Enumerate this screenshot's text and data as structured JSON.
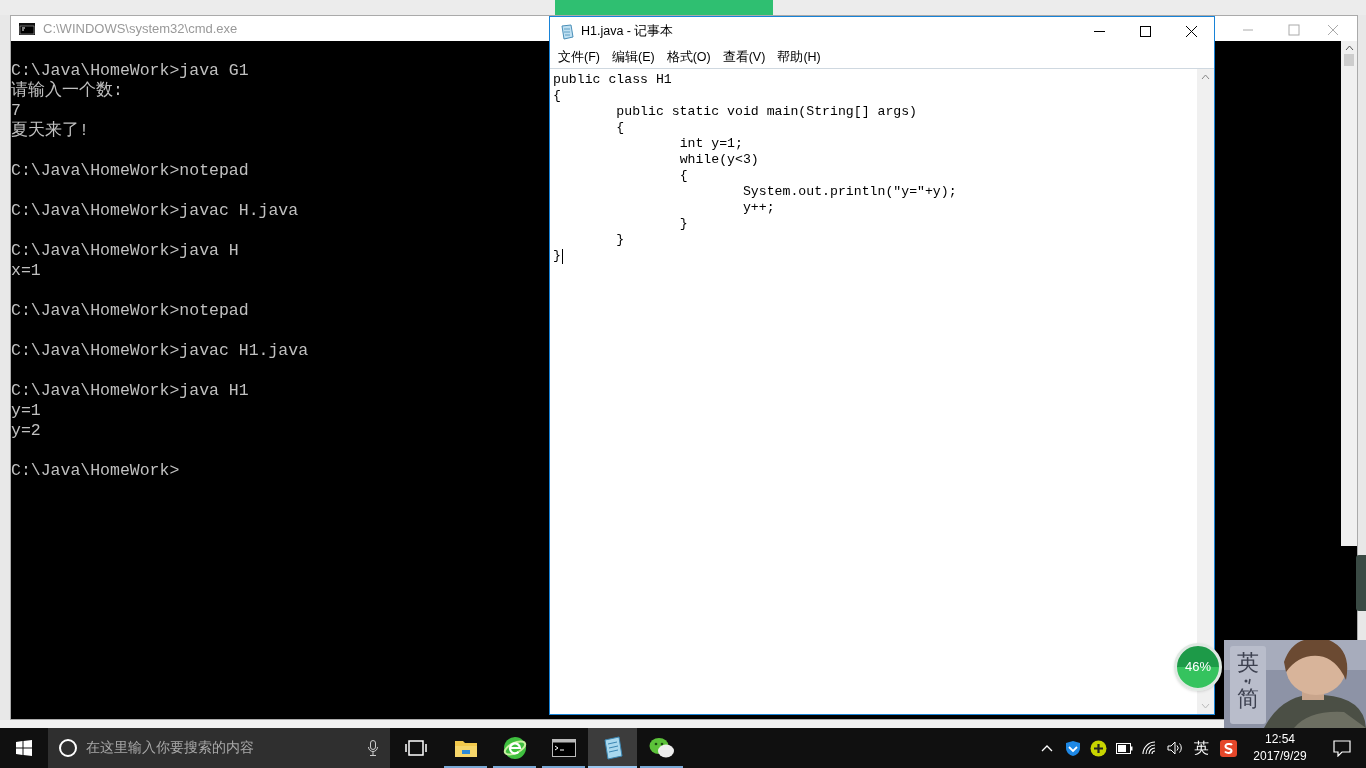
{
  "cmd_window": {
    "title": "C:\\WINDOWS\\system32\\cmd.exe",
    "blocks": [
      [
        "C:\\Java\\HomeWork>java G1",
        "请输入一个数:",
        "7",
        "夏天来了!"
      ],
      [
        "C:\\Java\\HomeWork>notepad"
      ],
      [
        "C:\\Java\\HomeWork>javac H.java"
      ],
      [
        "C:\\Java\\HomeWork>java H",
        "x=1"
      ],
      [
        "C:\\Java\\HomeWork>notepad"
      ],
      [
        "C:\\Java\\HomeWork>javac H1.java"
      ],
      [
        "C:\\Java\\HomeWork>java H1",
        "y=1",
        "y=2"
      ],
      [
        "C:\\Java\\HomeWork>"
      ]
    ]
  },
  "notepad": {
    "title": "H1.java - 记事本",
    "menu": [
      "文件(F)",
      "编辑(E)",
      "格式(O)",
      "查看(V)",
      "帮助(H)"
    ],
    "lines": [
      "public class H1",
      "{",
      "\tpublic static void main(String[] args)",
      "\t{",
      "\t\tint y=1;",
      "\t\twhile(y<3)",
      "\t\t{",
      "\t\t\tSystem.out.println(\"y=\"+y);",
      "\t\t\ty++;",
      "\t\t}",
      "\t}",
      "}"
    ]
  },
  "battery_badge": {
    "text": "46%"
  },
  "ime_widget": {
    "language": "英",
    "script": "简"
  },
  "taskbar": {
    "search_placeholder": "在这里输入你要搜索的内容",
    "apps": [
      {
        "kind": "folder",
        "selected": false
      },
      {
        "kind": "browser",
        "selected": false
      },
      {
        "kind": "console",
        "selected": false
      },
      {
        "kind": "notepad",
        "selected": true
      },
      {
        "kind": "chat",
        "selected": false
      }
    ],
    "tray": {
      "ime": "英",
      "time": "12:54",
      "date": "2017/9/29"
    }
  }
}
